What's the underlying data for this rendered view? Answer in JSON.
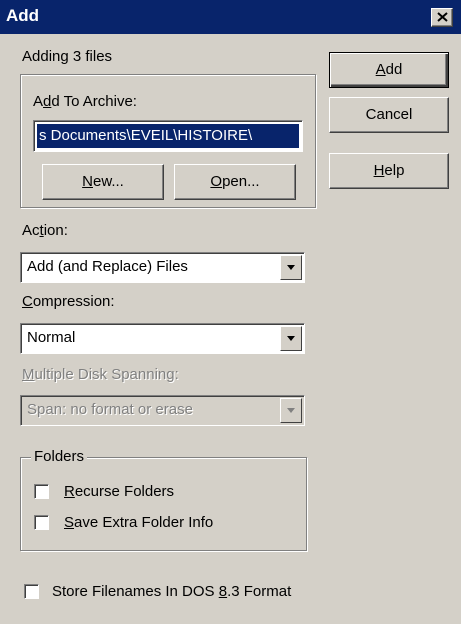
{
  "window": {
    "title": "Add"
  },
  "adding_info": "Adding 3 files",
  "archive_group": {
    "label_pre": "A",
    "label_mnemonic": "d",
    "label_post": "d To Archive:",
    "path_value": "s Documents\\EVEIL\\HISTOIRE\\",
    "new_button": {
      "mnemonic": "N",
      "rest": "ew..."
    },
    "open_button": {
      "mnemonic": "O",
      "rest": "pen..."
    }
  },
  "buttons": {
    "add": {
      "mnemonic": "A",
      "rest": "dd"
    },
    "cancel": "Cancel",
    "help": {
      "mnemonic": "H",
      "rest": "elp"
    }
  },
  "action": {
    "label_pre": "Ac",
    "label_mnemonic": "t",
    "label_post": "ion:",
    "value": "Add (and Replace) Files"
  },
  "compression": {
    "label_mnemonic": "C",
    "label_post": "ompression:",
    "value": "Normal"
  },
  "disk_spanning": {
    "label_mnemonic": "M",
    "label_post": "ultiple Disk Spanning:",
    "value": "Span: no format or erase"
  },
  "folders": {
    "legend": "Folders",
    "recurse": {
      "mnemonic": "R",
      "rest": "ecurse Folders",
      "checked": false
    },
    "extra_info": {
      "mnemonic": "S",
      "rest": "ave Extra Folder Info",
      "checked": false
    }
  },
  "dos_format": {
    "pre": "Store Filenames In DOS ",
    "mnemonic": "8",
    "post": ".3 Format",
    "checked": false
  }
}
